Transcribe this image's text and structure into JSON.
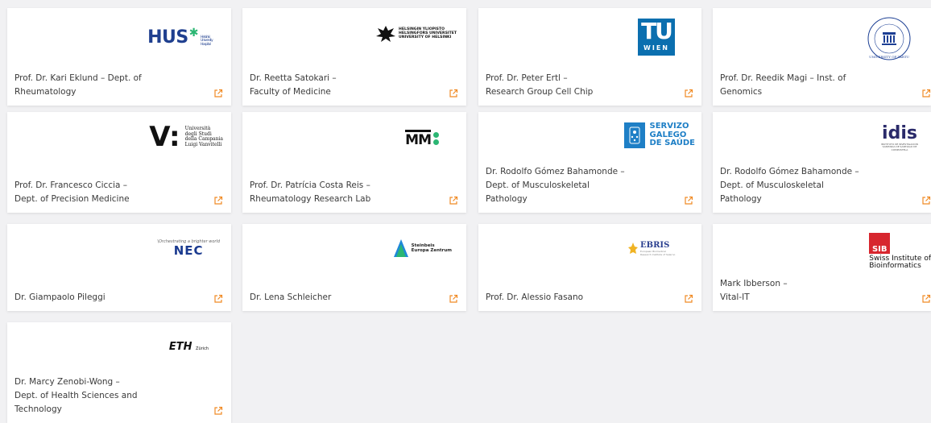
{
  "accent_color": "#f08a24",
  "icon_names": {
    "external_link": "external-link-icon"
  },
  "cards": [
    {
      "name": "Prof. Dr. Kari Eklund – Dept. of\nRheumatology",
      "logo_icon": "hus-logo",
      "logo": {
        "main": "HUS",
        "sub": "Helsinki University Hospital"
      }
    },
    {
      "name": "Dr. Reetta Satokari –\nFaculty of Medicine",
      "logo_icon": "university-of-helsinki-logo",
      "logo": {
        "main": "HELSINGIN YLIOPISTO\nHELSINGFORS UNIVERSITET\nUNIVERSITY OF HELSINKI"
      }
    },
    {
      "name": "Prof. Dr. Peter Ertl –\nResearch Group Cell Chip",
      "logo_icon": "tu-wien-logo",
      "logo": {
        "main": "TU",
        "sub": "WIEN"
      }
    },
    {
      "name": "Prof. Dr. Reedik Magi – Inst. of\nGenomics",
      "logo_icon": "university-of-tartu-seal",
      "logo": {
        "main": "UNIVERSITY OF TARTU"
      }
    },
    {
      "name": "Prof. Dr. Francesco Ciccia –\nDept. of Precision Medicine",
      "logo_icon": "vanvitelli-logo",
      "logo": {
        "main": "V:",
        "sub": "Università\ndegli Studi\ndella Campania\nLuigi Vanvitelli"
      }
    },
    {
      "name": "Prof. Dr. Patrícia Costa Reis –\nRheumatology Research Lab",
      "logo_icon": "imm-logo",
      "logo": {
        "main": "MM"
      }
    },
    {
      "name": "Dr. Rodolfo Gómez Bahamonde –\nDept. of Musculoskeletal\nPathology",
      "logo_icon": "servizo-galego-de-saude-logo",
      "logo": {
        "main": "SERVIZO\nGALEGO\nDE SAÚDE"
      }
    },
    {
      "name": "Dr. Rodolfo Gómez Bahamonde –\nDept. of Musculoskeletal\nPathology",
      "logo_icon": "idis-logo",
      "logo": {
        "main": "idis",
        "sub": "INSTITUTO DE INVESTIGACIÓN SANITARIA DE SANTIAGO DE COMPOSTELA"
      }
    },
    {
      "name": "Dr. Giampaolo Pileggi",
      "logo_icon": "nec-logo",
      "logo": {
        "main": "NEC",
        "sub": "\\Orchestrating a brighter world"
      }
    },
    {
      "name": "Dr. Lena Schleicher",
      "logo_icon": "steinbeis-logo",
      "logo": {
        "main": "Steinbeis\nEuropa Zentrum"
      }
    },
    {
      "name": "Prof. Dr. Alessio Fasano",
      "logo_icon": "ebris-logo",
      "logo": {
        "main": "EBRIS",
        "sub": "European Biomedical Research Institute of Salerno"
      }
    },
    {
      "name": "Mark Ibberson –\nVital-IT",
      "logo_icon": "sib-logo",
      "logo": {
        "main": "SIB",
        "sub": "Swiss Institute of\nBioinformatics"
      }
    },
    {
      "name": "Dr. Marcy Zenobi-Wong –\nDept. of Health Sciences and\nTechnology",
      "logo_icon": "eth-zurich-logo",
      "logo": {
        "main": "ETH",
        "sub": "Zürich"
      }
    }
  ]
}
